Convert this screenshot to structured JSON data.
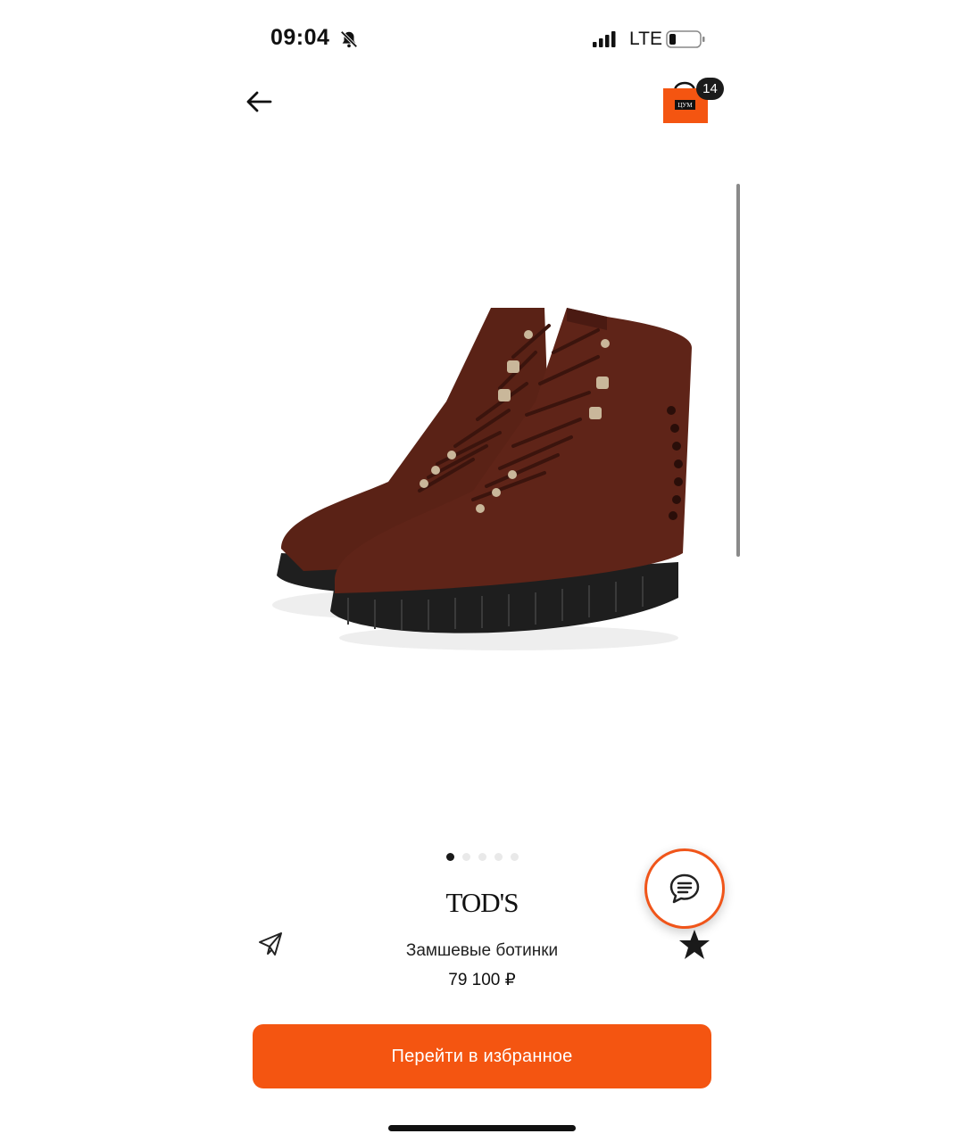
{
  "status_bar": {
    "time": "09:04",
    "network": "LTE",
    "icons": [
      "bell-slash-icon",
      "signal-icon",
      "battery-icon"
    ]
  },
  "header": {
    "back_icon": "arrow-left-icon",
    "cart_badge_count": "14",
    "cart_bag_label": "ЦУМ",
    "cart_color": "#f45511"
  },
  "gallery": {
    "page_count": 5,
    "active_index": 0
  },
  "product": {
    "brand": "TOD'S",
    "name": "Замшевые ботинки",
    "price": "79 100 ₽"
  },
  "actions": {
    "share_icon": "paper-plane-icon",
    "favorite_icon": "star-icon",
    "chat_icon": "chat-bubble-icon",
    "cta_label": "Перейти в избранное",
    "accent_color": "#f45511"
  }
}
